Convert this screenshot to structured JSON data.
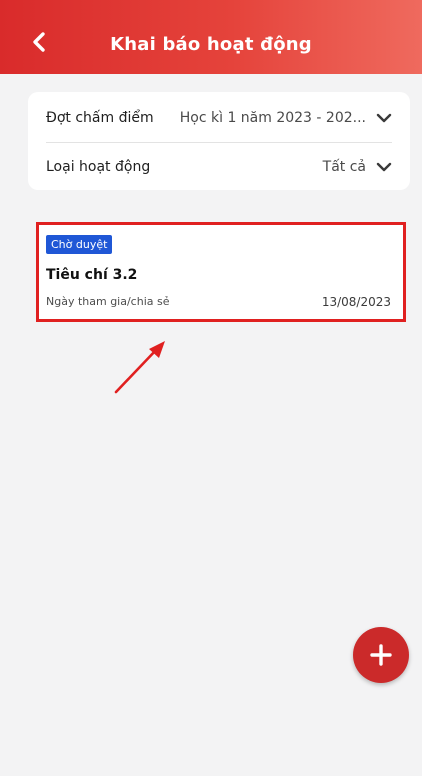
{
  "header": {
    "title": "Khai báo hoạt động",
    "background": "#e5433b"
  },
  "filters": [
    {
      "label": "Đợt chấm điểm",
      "value": "Học kì 1 năm 2023 - 202..."
    },
    {
      "label": "Loại hoạt động",
      "value": "Tất cả"
    }
  ],
  "activities": [
    {
      "status": "Chờ duyệt",
      "title": "Tiêu chí 3.2",
      "date_label": "Ngày tham gia/chia sẻ",
      "date": "13/08/2023"
    }
  ],
  "colors": {
    "accent": "#d92b2b",
    "status_badge": "#1f57d6",
    "highlight_border": "#e02020",
    "fab": "#cb2a2a"
  },
  "icons": {
    "back": "chevron-left-icon",
    "dropdown": "chevron-down-icon",
    "fab": "plus-icon",
    "annotation": "arrow-icon"
  }
}
